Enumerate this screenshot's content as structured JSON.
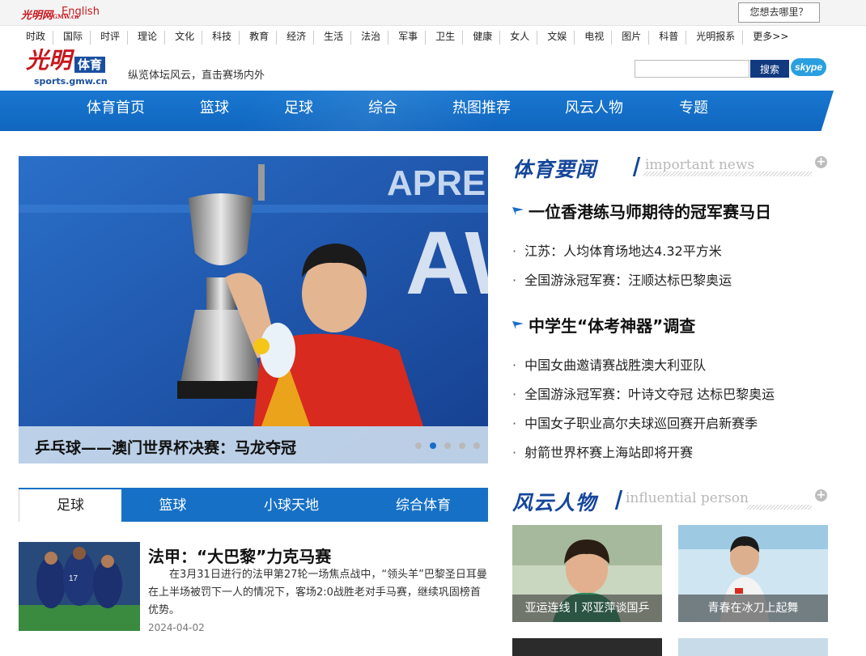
{
  "topbar": {
    "logo_text": "光明网",
    "logo_sub": "GMW.cn",
    "english": "English",
    "where_button": "您想去哪里？"
  },
  "channels": [
    "时政",
    "国际",
    "时评",
    "理论",
    "文化",
    "科技",
    "教育",
    "经济",
    "生活",
    "法治",
    "军事",
    "卫生",
    "健康",
    "女人",
    "文娱",
    "电视",
    "图片",
    "科普",
    "光明报系",
    "更多>>"
  ],
  "header": {
    "brand_glyph": "光明",
    "brand_badge": "体育",
    "brand_url": "sports.gmw.cn",
    "slogan": "纵览体坛风云，直击赛场内外",
    "search_value": "",
    "search_button": "搜索",
    "skype": "skype"
  },
  "mainnav": [
    "体育首页",
    "篮球",
    "足球",
    "综合",
    "热图推荐",
    "风云人物",
    "专题"
  ],
  "slider": {
    "caption": "乒乓球——澳门世界杯决赛：马龙夺冠",
    "backdrop_text": "APRE",
    "backdrop_text2": "AW",
    "dot_count": 5,
    "active_dot": 1
  },
  "tabs": [
    "足球",
    "篮球",
    "小球天地",
    "综合体育"
  ],
  "article": {
    "title": "法甲：“大巴黎”力克马赛",
    "summary": "在3月31日进行的法甲第27轮一场焦点战中，“领头羊”巴黎圣日耳曼在上半场被罚下一人的情况下，客场2:0战胜老对手马赛，继续巩固榜首优势。",
    "date": "2024-04-02"
  },
  "news": {
    "heading_zh": "体育要闻",
    "heading_en": "important news",
    "headline1": "一位香港练马师期待的冠军赛马日",
    "items1": [
      "江苏：人均体育场地达4.32平方米",
      "全国游泳冠军赛：汪顺达标巴黎奥运"
    ],
    "headline2": "中学生“体考神器”调查",
    "items2": [
      "中国女曲邀请赛战胜澳大利亚队",
      "全国游泳冠军赛：叶诗文夺冠 达标巴黎奥运",
      "中国女子职业高尔夫球巡回赛开启新赛季",
      "射箭世界杯赛上海站即将开赛"
    ]
  },
  "people": {
    "heading_zh": "风云人物",
    "heading_en": "influential person",
    "cards": [
      {
        "label": "亚运连线丨邓亚萍谈国乒"
      },
      {
        "label": "青春在冰刀上起舞"
      }
    ]
  },
  "colors": {
    "brand_red": "#c8161d",
    "nav_blue": "#1670c6",
    "heading_blue": "#15469a"
  }
}
